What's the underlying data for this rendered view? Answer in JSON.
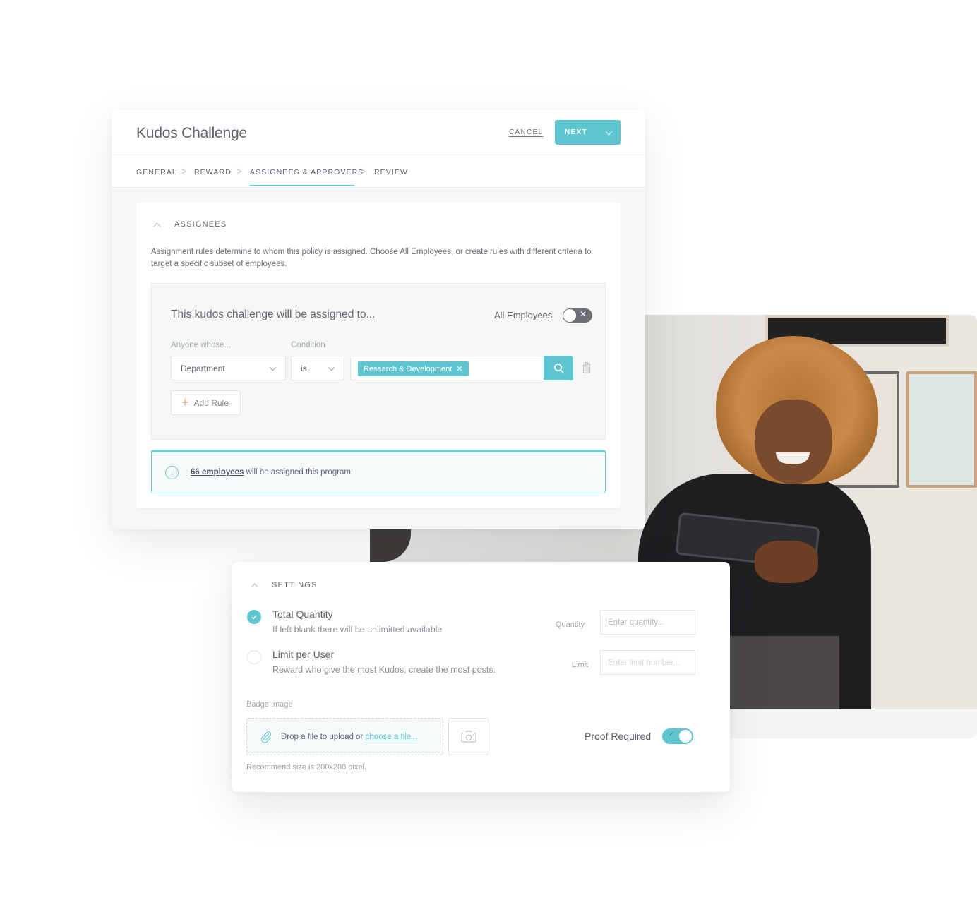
{
  "wizard": {
    "title": "Kudos Challenge",
    "cancel_label": "CANCEL",
    "next_label": "NEXT",
    "steps": [
      {
        "label": "GENERAL",
        "active": false
      },
      {
        "label": "REWARD",
        "active": false
      },
      {
        "label": "ASSIGNEES & APPROVERS",
        "active": true
      },
      {
        "label": "REVIEW",
        "active": false
      }
    ],
    "separator": ">"
  },
  "assignees": {
    "heading": "ASSIGNEES",
    "description": "Assignment rules determine to whom this policy is assigned. Choose All Employees, or create rules with different criteria to target a specific subset of employees.",
    "rule_title": "This kudos challenge will be assigned to...",
    "all_employees_label": "All Employees",
    "all_employees_enabled": false,
    "field_label": "Anyone whose...",
    "condition_label": "Condition",
    "field_value": "Department",
    "condition_value": "is",
    "tags": [
      "Research & Development"
    ],
    "add_rule_label": "Add Rule",
    "info_link": "66 employees",
    "info_text": " will be assigned this program."
  },
  "settings": {
    "heading": "SETTINGS",
    "options": [
      {
        "name": "Total Quantity",
        "description": "If left blank there will be unlimitted available",
        "selected": true,
        "side_label": "Quantity",
        "placeholder": "Enter quantity..."
      },
      {
        "name": "Limit per User",
        "description": "Reward who give the most Kudos, create the most posts.",
        "selected": false,
        "side_label": "Limit",
        "placeholder": "Enter limit number..."
      }
    ],
    "badge_label": "Badge Image",
    "drop_text": "Drop a file to upload or ",
    "drop_link": "choose a file...",
    "recommend_text": "Recommend size is 200x200 pixel.",
    "proof_label": "Proof Required",
    "proof_enabled": true
  },
  "colors": {
    "accent": "#5fc6cf",
    "text": "#5a6066",
    "muted": "#a8adb1",
    "toggle_off": "#6b7177"
  },
  "photo": {
    "subject": "smiling woman with curly hair holding a tablet"
  }
}
